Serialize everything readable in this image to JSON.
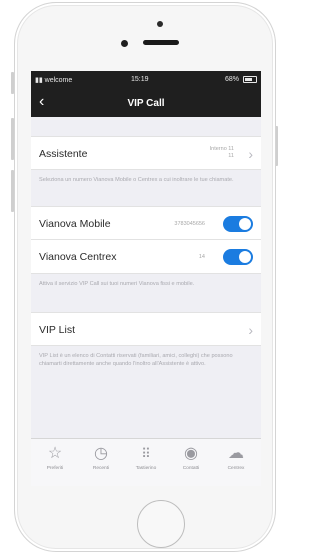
{
  "status_bar": {
    "carrier": "welcome",
    "time": "15:19",
    "battery": "68%"
  },
  "nav": {
    "back_icon": "chevron-left-icon",
    "title": "VIP Call"
  },
  "assistente": {
    "label": "Assistente",
    "value_line1": "Interno 11",
    "value_line2": "11",
    "note": "Seleziona un numero Vianova Mobile o Centrex a cui inoltrare le tue chiamate."
  },
  "vianova_mobile": {
    "label": "Vianova Mobile",
    "value": "3783045656",
    "enabled": true
  },
  "vianova_centrex": {
    "label": "Vianova Centrex",
    "value": "14",
    "enabled": true,
    "note": "Attiva il servizio VIP Call sui tuoi numeri Vianova fissi e mobile."
  },
  "vip_list": {
    "label": "VIP List",
    "note": "VIP List è un elenco di Contatti riservati (familiari, amici, colleghi) che possono chiamarti direttamente anche quando l'inoltro all'Assistente è attivo."
  },
  "tabbar": {
    "items": [
      {
        "label": "Preferiti",
        "icon": "star-icon"
      },
      {
        "label": "Recenti",
        "icon": "clock-icon"
      },
      {
        "label": "Tastierino",
        "icon": "keypad-icon"
      },
      {
        "label": "Contatti",
        "icon": "contact-icon"
      },
      {
        "label": "Centrex",
        "icon": "cloud-icon"
      }
    ]
  },
  "colors": {
    "toggle_on": "#1b7ce0",
    "navbar": "#1f1f1f",
    "background": "#efeff4"
  }
}
